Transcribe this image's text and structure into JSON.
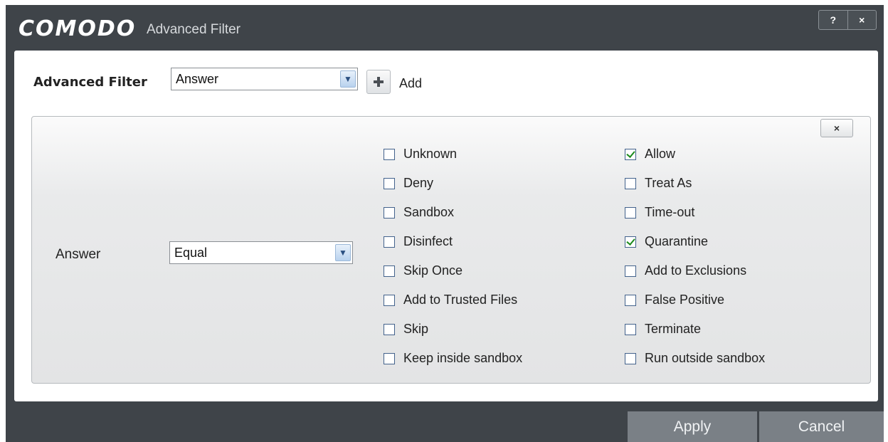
{
  "window": {
    "brand": "COMODO",
    "title": "Advanced Filter",
    "help_label": "?",
    "close_label": "×"
  },
  "filter": {
    "label": "Advanced Filter",
    "selected": "Answer",
    "add_label": "Add"
  },
  "condition": {
    "label": "Answer",
    "operator": "Equal",
    "remove_label": "×",
    "options_left": [
      {
        "label": "Unknown",
        "checked": false
      },
      {
        "label": "Deny",
        "checked": false
      },
      {
        "label": "Sandbox",
        "checked": false
      },
      {
        "label": "Disinfect",
        "checked": false
      },
      {
        "label": "Skip Once",
        "checked": false
      },
      {
        "label": "Add to Trusted Files",
        "checked": false
      },
      {
        "label": "Skip",
        "checked": false
      },
      {
        "label": "Keep inside sandbox",
        "checked": false
      }
    ],
    "options_right": [
      {
        "label": "Allow",
        "checked": true
      },
      {
        "label": "Treat As",
        "checked": false
      },
      {
        "label": "Time-out",
        "checked": false
      },
      {
        "label": "Quarantine",
        "checked": true
      },
      {
        "label": "Add to Exclusions",
        "checked": false
      },
      {
        "label": "False Positive",
        "checked": false
      },
      {
        "label": "Terminate",
        "checked": false
      },
      {
        "label": "Run outside sandbox",
        "checked": false
      }
    ]
  },
  "footer": {
    "apply_label": "Apply",
    "cancel_label": "Cancel"
  },
  "colors": {
    "window_bg": "#3f4449",
    "button_bg": "#7a8086",
    "check_color": "#1c8a1c"
  }
}
